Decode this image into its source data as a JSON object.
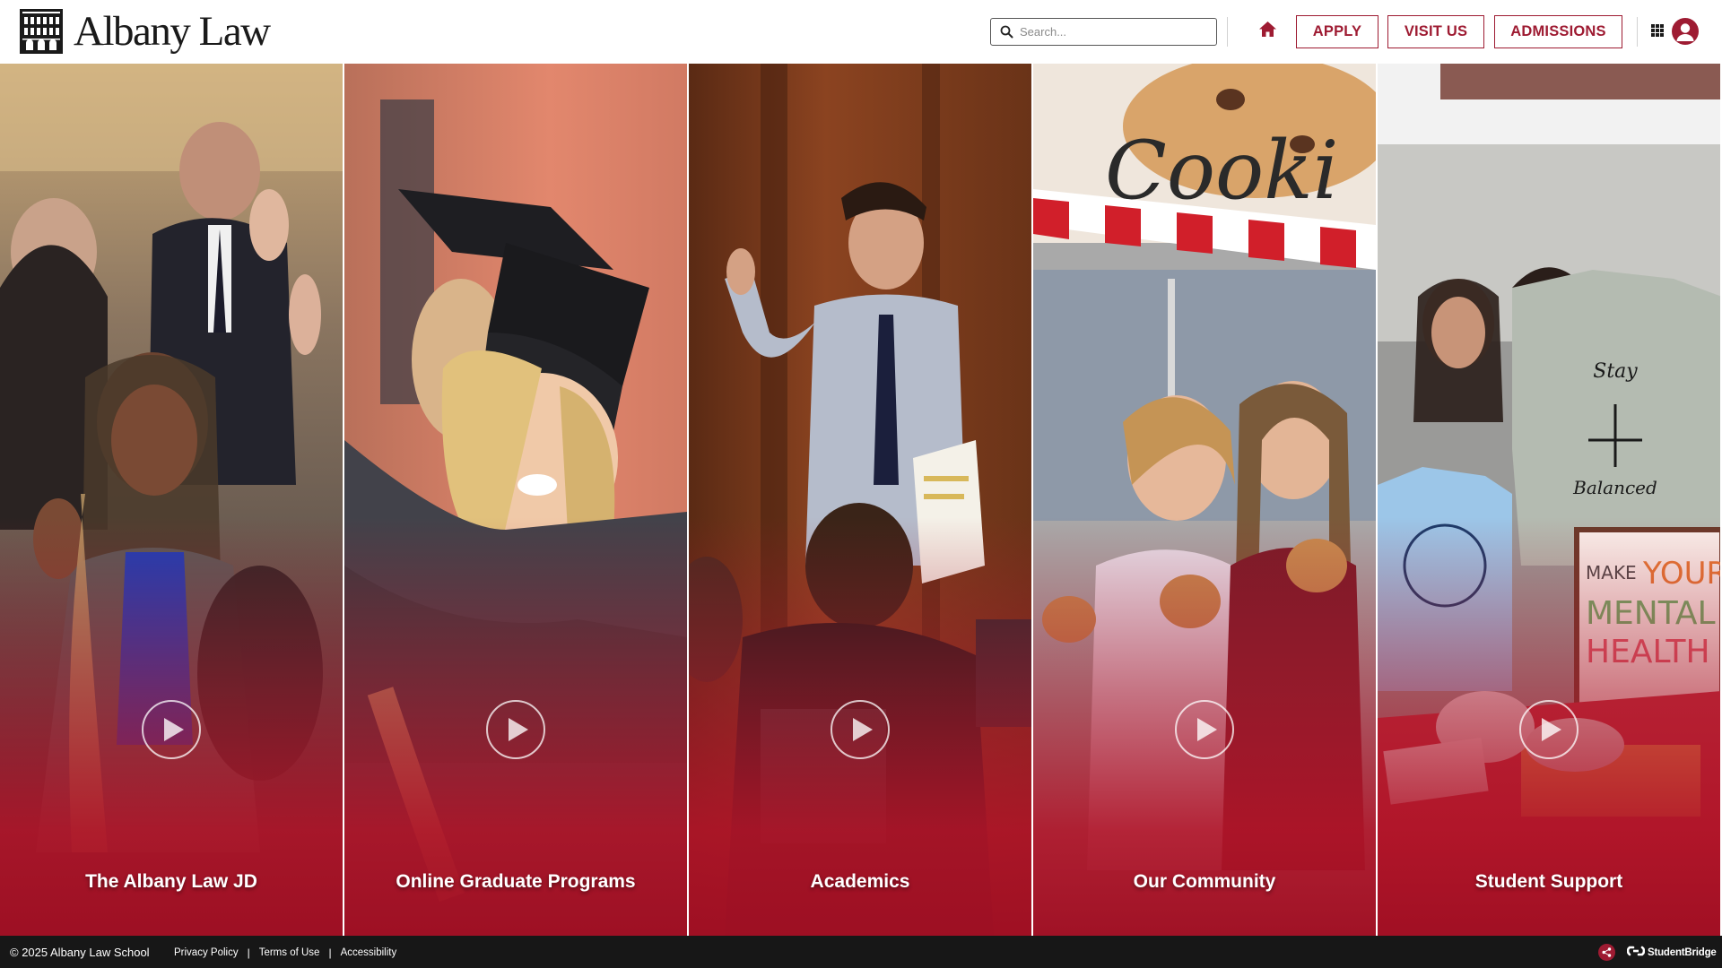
{
  "header": {
    "logo_text": "Albany Law",
    "logo_icon": "building-icon",
    "search": {
      "placeholder": "Search...",
      "icon": "search-icon"
    },
    "home_icon": "home-icon",
    "nav": {
      "apply": "APPLY",
      "visit": "VISIT US",
      "admissions": "ADMISSIONS"
    },
    "menu_icon": "grid-menu-icon",
    "account_icon": "user-account-icon"
  },
  "panels": [
    {
      "label": "The Albany Law JD",
      "play_icon": "play-icon"
    },
    {
      "label": "Online Graduate Programs",
      "play_icon": "play-icon"
    },
    {
      "label": "Academics",
      "play_icon": "play-icon"
    },
    {
      "label": "Our Community",
      "play_icon": "play-icon"
    },
    {
      "label": "Student Support",
      "play_icon": "play-icon"
    }
  ],
  "footer": {
    "copyright": "© 2025 Albany Law School",
    "links": {
      "privacy": "Privacy Policy",
      "terms": "Terms of Use",
      "accessibility": "Accessibility"
    },
    "share_icon": "share-icon",
    "credit": "StudentBridge"
  },
  "colors": {
    "brand": "#9e1b32",
    "footer_bg": "#171717",
    "overlay": "#a8172f"
  }
}
